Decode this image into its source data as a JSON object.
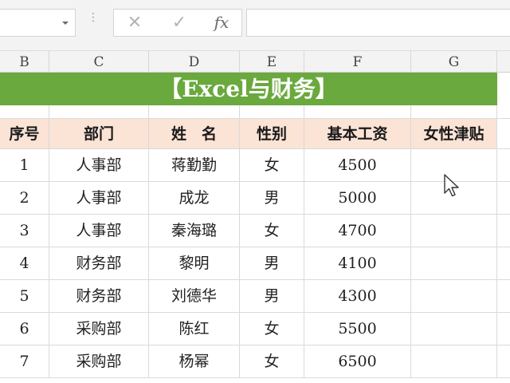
{
  "formula_bar": {
    "cancel_icon": "cross-icon",
    "enter_icon": "check-icon",
    "function_label": "fx",
    "formula_value": ""
  },
  "column_headers": [
    "B",
    "C",
    "D",
    "E",
    "F",
    "G"
  ],
  "sheet": {
    "title": "【Excel与财务】",
    "headers": [
      "序号",
      "部门",
      "姓　名",
      "性别",
      "基本工资",
      "女性津贴"
    ],
    "rows": [
      [
        "1",
        "人事部",
        "蒋勤勤",
        "女",
        "4500",
        ""
      ],
      [
        "2",
        "人事部",
        "成龙",
        "男",
        "5000",
        ""
      ],
      [
        "3",
        "人事部",
        "秦海璐",
        "女",
        "4700",
        ""
      ],
      [
        "4",
        "财务部",
        "黎明",
        "男",
        "4100",
        ""
      ],
      [
        "5",
        "财务部",
        "刘德华",
        "男",
        "4300",
        ""
      ],
      [
        "6",
        "采购部",
        "陈红",
        "女",
        "5500",
        ""
      ],
      [
        "7",
        "采购部",
        "杨幂",
        "女",
        "6500",
        ""
      ]
    ]
  },
  "colors": {
    "title_bg": "#6aa93d",
    "header_bg": "#fbe3d6",
    "chrome_bg": "#f3f3f3"
  }
}
